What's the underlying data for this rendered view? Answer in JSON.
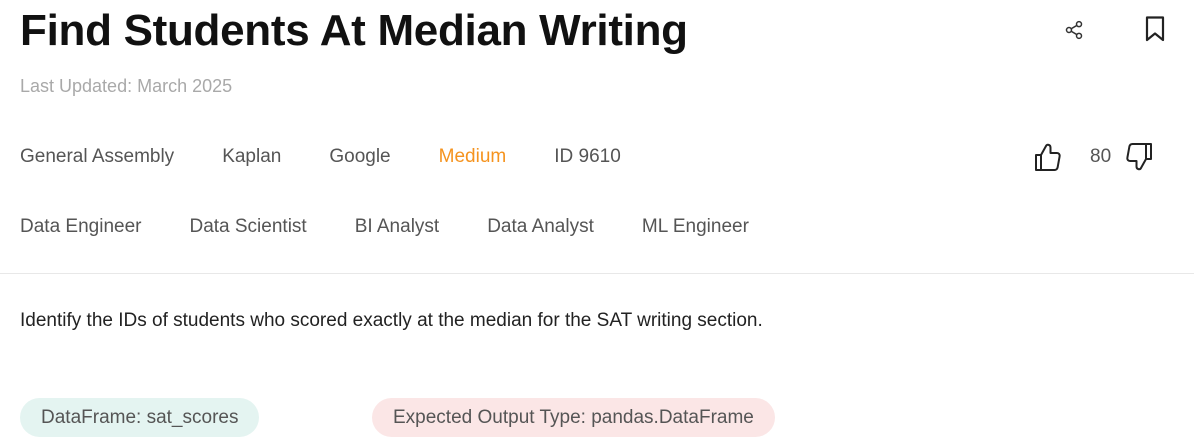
{
  "header": {
    "title": "Find Students At Median Writing",
    "last_updated": "Last Updated: March 2025",
    "share_icon": "share-icon",
    "bookmark_icon": "bookmark-icon"
  },
  "meta_tags": [
    "General Assembly",
    "Kaplan",
    "Google"
  ],
  "difficulty": {
    "label": "Medium",
    "color": "#f5931e"
  },
  "question_id": "ID 9610",
  "votes": {
    "count": "80",
    "upvote_icon": "thumbs-up-icon",
    "downvote_icon": "thumbs-down-icon"
  },
  "roles": [
    "Data Engineer",
    "Data Scientist",
    "BI Analyst",
    "Data Analyst",
    "ML Engineer"
  ],
  "description": "Identify the IDs of students who scored exactly at the median for the SAT writing section.",
  "dataframe_pill": {
    "label": "DataFrame: sat_scores",
    "color": "#e4f4f1"
  },
  "output_pill": {
    "label": "Expected Output Type: pandas.DataFrame",
    "color": "#fbe6e6"
  }
}
